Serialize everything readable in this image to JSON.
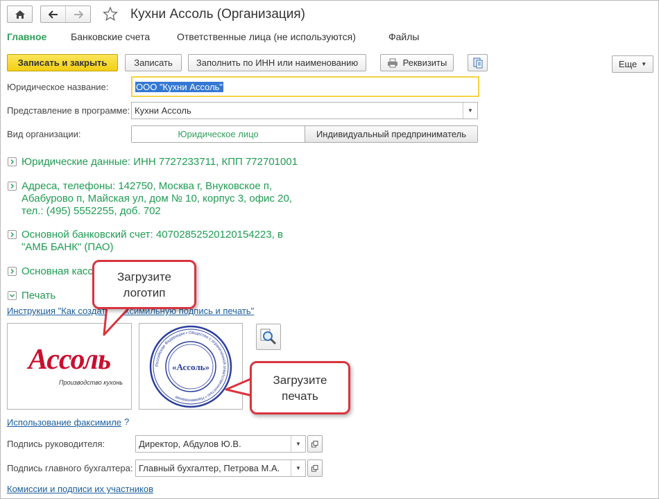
{
  "window": {
    "title": "Кухни Ассоль (Организация)"
  },
  "tabs": [
    {
      "label": "Главное"
    },
    {
      "label": "Банковские счета"
    },
    {
      "label": "Ответственные лица (не используются)"
    },
    {
      "label": "Файлы"
    }
  ],
  "toolbar": {
    "save_close": "Записать и закрыть",
    "save": "Записать",
    "fill_inn": "Заполнить по ИНН или наименованию",
    "requisites": "Реквизиты",
    "more": "Еще"
  },
  "form": {
    "legal_name_label": "Юридическое название:",
    "legal_name_value": "ООО \"Кухни Ассоль\"",
    "display_label": "Представление в программе:",
    "display_value": "Кухни Ассоль",
    "org_type_label": "Вид организации:",
    "org_type_options": [
      "Юридическое лицо",
      "Индивидуальный предприниматель"
    ],
    "selected_org_type": "Юридическое лицо"
  },
  "sections": {
    "legal": "Юридические данные: ИНН 7727233711, КПП 772701001",
    "address_l1": "Адреса, телефоны: 142750, Москва г, Внуковское п,",
    "address_l2": "Абабурово п, Майская ул, дом № 10, корпус 3, офис 20,",
    "address_l3": "тел.: (495) 5552255, доб. 702",
    "bank_l1": "Основной банковский счет: 40702852520120154223, в",
    "bank_l2": "\"АМБ БАНК\" (ПАО)",
    "cashbox": "Основная касса",
    "print": "Печать"
  },
  "instruction_link": "Инструкция \"Как создать факсимильную подпись и печать\"",
  "logo": {
    "brand": "Ассоль",
    "tagline": "Производство кухонь"
  },
  "stamp": {
    "center": "«Ассоль»",
    "ring_text": "Российская Федерация • Общество с ограниченной ответственностью • Наименование"
  },
  "facsimile_link": "Использование факсимиле",
  "help_mark": "?",
  "signatures": {
    "director_label": "Подпись руководителя:",
    "director_value": "Директор, Абдулов Ю.В.",
    "accountant_label": "Подпись главного бухгалтера:",
    "accountant_value": "Главный бухгалтер, Петрова М.А."
  },
  "commissions_link": "Комиссии и подписи их участников",
  "callouts": {
    "logo_l1": "Загрузите",
    "logo_l2": "логотип",
    "stamp_l1": "Загрузите",
    "stamp_l2": "печать"
  },
  "colors": {
    "accent_green": "#1e9c52",
    "callout_red": "#d9343e",
    "brand_red": "#c8102e",
    "stamp_blue": "#2a3f9c"
  }
}
